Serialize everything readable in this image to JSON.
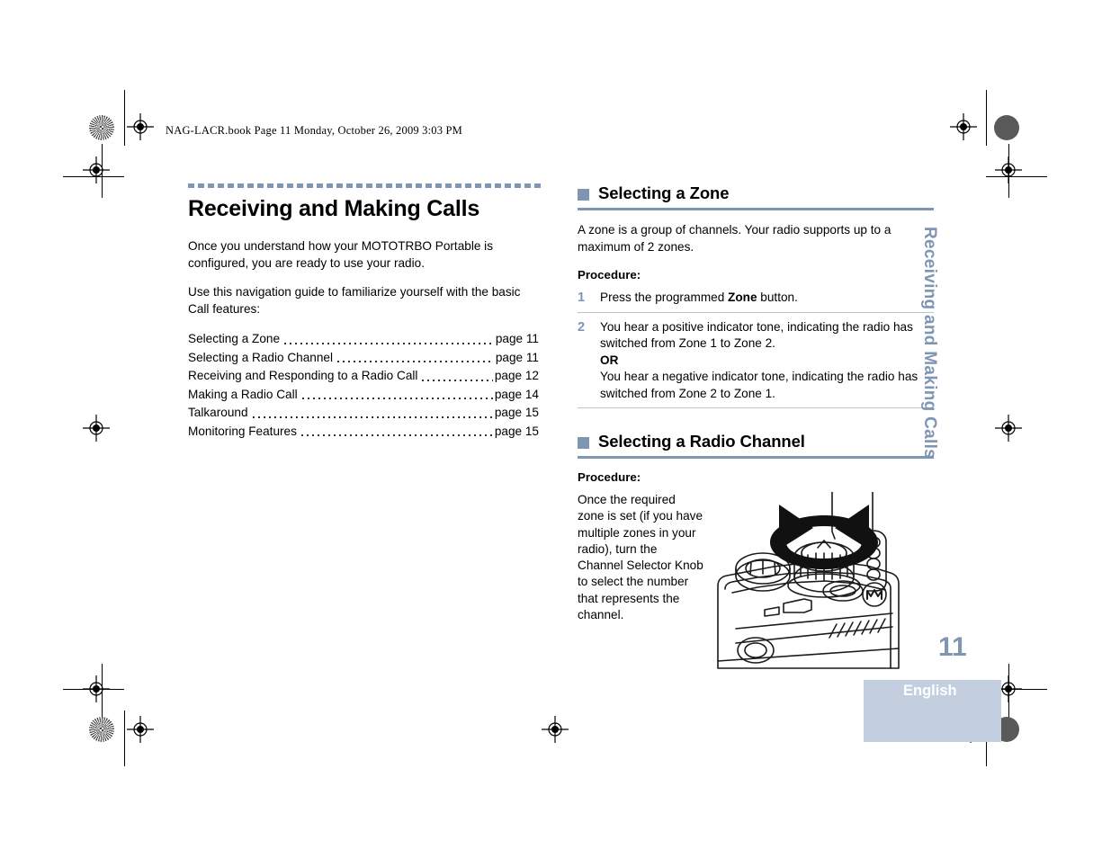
{
  "print_header": "NAG-LACR.book  Page 11  Monday, October 26, 2009  3:03 PM",
  "colors": {
    "accent": "#7e95b4",
    "tab_background": "#c3cfdf",
    "rule": "#b9c4d2",
    "text": "#000000"
  },
  "left_column": {
    "chapter_title": "Receiving and Making Calls",
    "intro_paragraph": "Once you understand how your MOTOTRBO Portable is configured, you are ready to use your radio.",
    "nav_paragraph": "Use this navigation guide to familiarize yourself with the basic Call features:",
    "toc": [
      {
        "label": "Selecting a Zone",
        "page": "page 11"
      },
      {
        "label": "Selecting a Radio Channel",
        "page": "page 11"
      },
      {
        "label": "Receiving and Responding to a Radio Call",
        "page": "page 12"
      },
      {
        "label": "Making a Radio Call",
        "page": "page 14"
      },
      {
        "label": "Talkaround",
        "page": "page 15"
      },
      {
        "label": "Monitoring Features",
        "page": "page 15"
      }
    ]
  },
  "right_column": {
    "zone_section": {
      "title": "Selecting a Zone",
      "body": "A zone is a group of channels. Your radio supports up to a maximum of 2 zones.",
      "procedure_label": "Procedure:",
      "steps": [
        {
          "number": "1",
          "text_before": "Press the programmed ",
          "bold": "Zone",
          "text_after": " button."
        },
        {
          "number": "2",
          "line1": "You hear a positive indicator tone, indicating the radio has switched from Zone 1 to Zone 2.",
          "or": "OR",
          "line2": "You hear a negative indicator tone, indicating the radio has switched from Zone 2 to Zone 1."
        }
      ]
    },
    "channel_section": {
      "title": "Selecting a Radio Channel",
      "procedure_label": "Procedure:",
      "body": "Once the required zone is set (if you have multiple zones in your radio), turn the Channel Selector Knob to select the number that represents the channel.",
      "figure_caption": "radio-channel-selector-knob-illustration"
    }
  },
  "margin": {
    "running_head": "Receiving and Making Calls",
    "page_number": "11",
    "language": "English"
  }
}
